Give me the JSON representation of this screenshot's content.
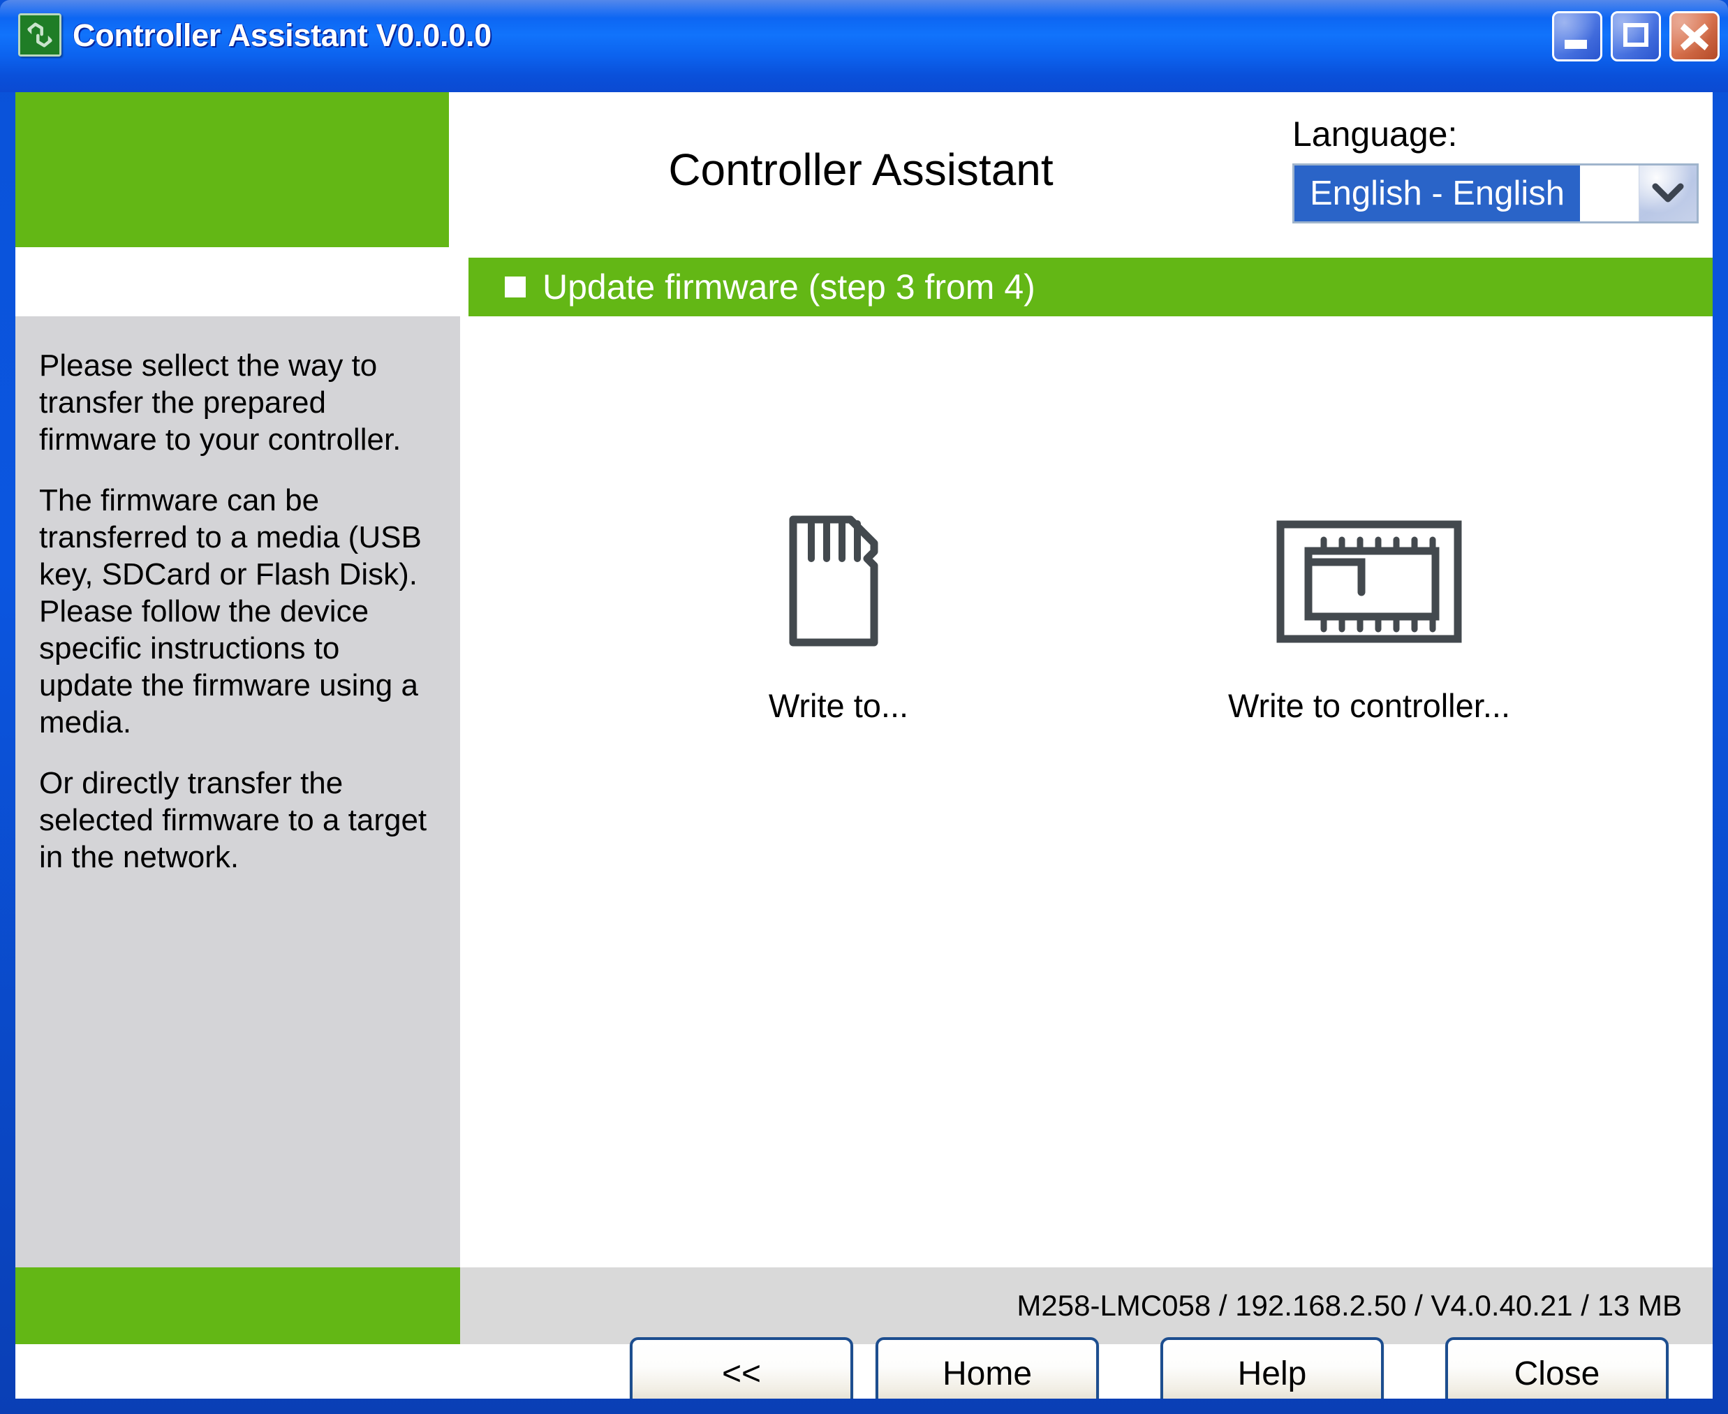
{
  "window": {
    "title": "Controller Assistant V0.0.0.0",
    "app_icon": "refresh-cycle-icon",
    "controls": {
      "minimize": "minimize-icon",
      "maximize": "maximize-icon",
      "close": "close-icon"
    }
  },
  "header": {
    "app_title": "Controller Assistant",
    "language_label": "Language:",
    "language_value": "English - English",
    "dropdown_icon": "chevron-down-icon"
  },
  "step_banner": {
    "bullet": "square-bullet-icon",
    "text": "Update firmware (step 3 from 4)"
  },
  "sidebar": {
    "paragraphs": [
      "Please sellect the way to transfer the prepared firmware to your controller.",
      "The firmware can be transferred to a media (USB key, SDCard or Flash Disk). Please follow the device specific instructions to update the firmware using a media.",
      "Or directly transfer the selected firmware to a target in the network."
    ]
  },
  "content": {
    "choices": [
      {
        "icon": "sd-card-icon",
        "label": "Write to..."
      },
      {
        "icon": "controller-chip-icon",
        "label": "Write to controller..."
      }
    ]
  },
  "status_bar": {
    "text": "M258-LMC058 / 192.168.2.50 / V4.0.40.21 / 13 MB"
  },
  "buttons": {
    "back": "<<",
    "home": "Home",
    "help": "Help",
    "close": "Close"
  },
  "colors": {
    "brand_green": "#63b715",
    "title_blue": "#0b61f0",
    "sidebar_grey": "#d4d4d7",
    "status_grey": "#d9d9d9",
    "select_highlight": "#2a64c8",
    "icon_stroke": "#43494e",
    "button_border": "#1d4e8f"
  }
}
